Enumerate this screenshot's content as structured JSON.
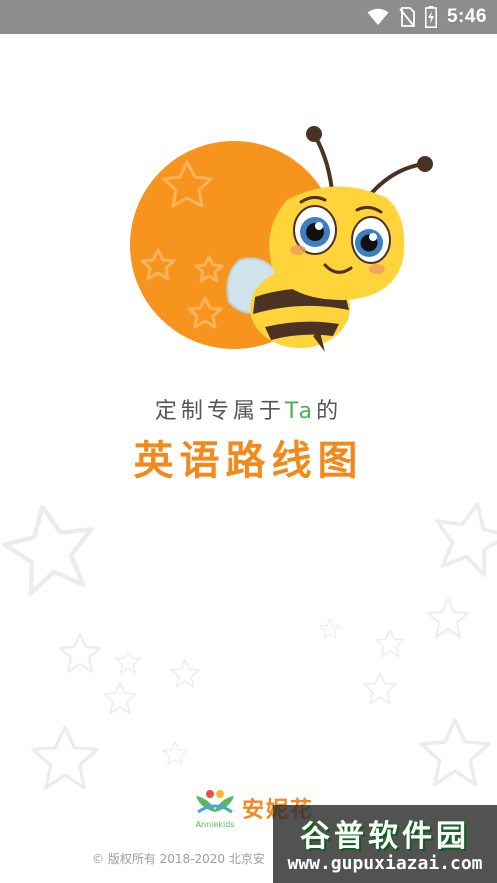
{
  "status_bar": {
    "time": "5:46",
    "icons": [
      "wifi-icon",
      "no-sim-icon",
      "battery-charging-icon"
    ]
  },
  "splash": {
    "tagline_prefix": "定制专属于",
    "tagline_accent": "Ta",
    "tagline_suffix": "的",
    "headline": "英语路线图"
  },
  "brand": {
    "name": "安妮花",
    "logo_text": "Anniekids"
  },
  "footer": {
    "copyright": "© 版权所有 2018-2020 北京安"
  },
  "watermark": {
    "title": "谷普软件园",
    "url": "www.gupuxiazai.com"
  },
  "colors": {
    "status_bar": "#8d8d8d",
    "accent_orange": "#f28a1b",
    "accent_green": "#4caf50",
    "bee_yellow": "#ffd43b"
  }
}
